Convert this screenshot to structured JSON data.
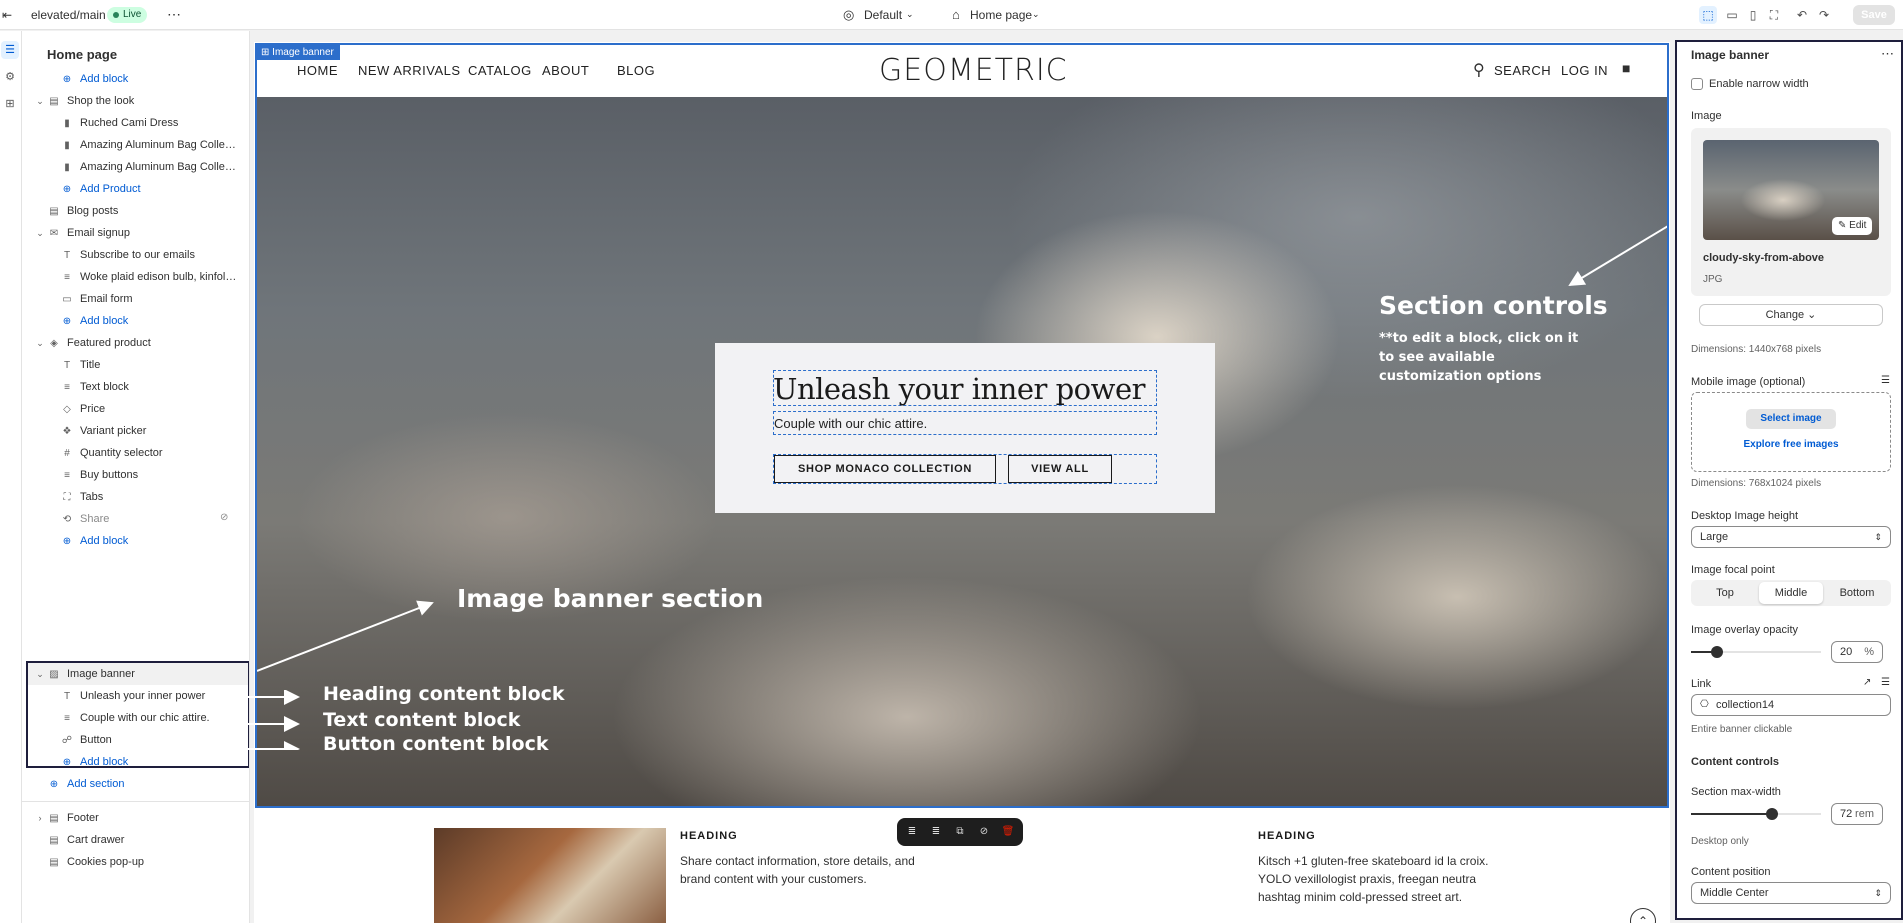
{
  "topbar": {
    "theme_name": "elevated/main",
    "live_label": "Live",
    "more_icon": "ellipsis-icon",
    "template_label": "Default",
    "page_label": "Home page",
    "save_label": "Save"
  },
  "sidebar": {
    "title": "Home page",
    "rows": {
      "add_block_top": "Add block",
      "shop_the_look": "Shop the look",
      "ruched_cami": "Ruched Cami Dress",
      "bag_1": "Amazing Aluminum Bag Collecti...",
      "bag_2": "Amazing Aluminum Bag Collecti...",
      "add_product": "Add Product",
      "blog_posts": "Blog posts",
      "email_signup": "Email signup",
      "subscribe": "Subscribe to our emails",
      "woke": "Woke plaid edison bulb, kinfolk s...",
      "email_form": "Email form",
      "add_block_email": "Add block",
      "featured_product": "Featured product",
      "fp_title": "Title",
      "fp_text": "Text block",
      "fp_price": "Price",
      "fp_variant": "Variant picker",
      "fp_qty": "Quantity selector",
      "fp_buy": "Buy buttons",
      "fp_tabs": "Tabs",
      "fp_share": "Share",
      "add_block_fp": "Add block",
      "image_banner": "Image banner",
      "ib_heading": "Unleash your inner power",
      "ib_text": "Couple with our chic attire.",
      "ib_button": "Button",
      "add_block_ib": "Add block",
      "add_section": "Add section",
      "footer": "Footer",
      "cart_drawer": "Cart drawer",
      "cookies": "Cookies pop-up"
    }
  },
  "canvas": {
    "banner_tag": "Image banner",
    "nav": [
      "HOME",
      "NEW ARRIVALS",
      "CATALOG",
      "ABOUT",
      "BLOG"
    ],
    "logo": "GEOMETRIC",
    "search_label": "SEARCH",
    "login_label": "LOG IN",
    "hero_heading": "Unleash your inner power",
    "hero_text": "Couple with our chic attire.",
    "btn_primary": "SHOP MONACO COLLECTION",
    "btn_secondary": "VIEW ALL",
    "below": {
      "heading_1": "HEADING",
      "text_1": "Share contact information, store details, and brand content with your customers.",
      "heading_2": "HEADING",
      "text_2": "Kitsch +1 gluten-free skateboard id la croix. YOLO vexillologist praxis, freegan neutra hashtag minim cold-pressed street art."
    }
  },
  "annotations": {
    "section_controls": "Section controls",
    "section_controls_note": "**to edit a block, click on it to see available customization options",
    "image_banner_section": "Image banner section",
    "heading_block": "Heading content block",
    "text_block": "Text content block",
    "button_block": "Button content block"
  },
  "panel": {
    "title": "Image banner",
    "narrow_width": "Enable narrow width",
    "image_label": "Image",
    "edit_label": "Edit",
    "file_name": "cloudy-sky-from-above",
    "file_type": "JPG",
    "change_label": "Change",
    "dims_desktop": "Dimensions: 1440x768 pixels",
    "mobile_label": "Mobile image (optional)",
    "select_image": "Select image",
    "explore_images": "Explore free images",
    "dims_mobile": "Dimensions: 768x1024 pixels",
    "height_label": "Desktop Image height",
    "height_value": "Large",
    "focal_label": "Image focal point",
    "focal_options": [
      "Top",
      "Middle",
      "Bottom"
    ],
    "focal_selected": "Middle",
    "overlay_label": "Image overlay opacity",
    "overlay_value": "20",
    "overlay_unit": "%",
    "overlay_fraction": 0.2,
    "link_label": "Link",
    "link_value": "collection14",
    "clickable_note": "Entire banner clickable",
    "content_controls": "Content controls",
    "max_width_label": "Section max-width",
    "max_width_value": "72",
    "max_width_unit": "rem",
    "max_width_fraction": 0.62,
    "desktop_only": "Desktop only",
    "position_label": "Content position",
    "position_value": "Middle Center"
  },
  "colors": {
    "accent": "#2c6ecb",
    "link": "#005bd3",
    "annotation_border": "#1e1e3c"
  }
}
